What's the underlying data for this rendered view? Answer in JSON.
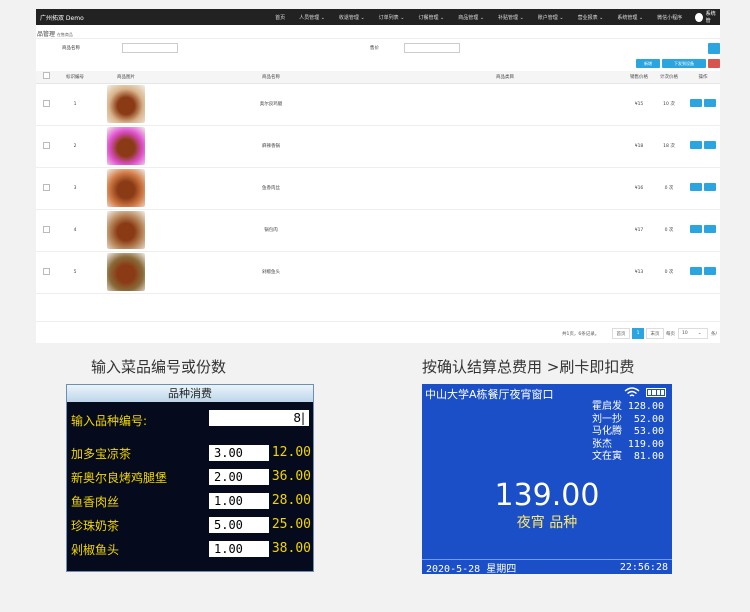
{
  "admin": {
    "brand": "广州拓双 Demo",
    "nav": [
      "首页",
      "人员管理 ⌄",
      "收退管理 ⌄",
      "订单列表 ⌄",
      "订餐管理 ⌄",
      "商品管理 ⌄",
      "补贴管理 ⌄",
      "账户管理 ⌄",
      "营业报表 ⌄",
      "系统管理 ⌄",
      "微信小程序"
    ],
    "user_label": "系统管",
    "breadcrumb": "品管理",
    "breadcrumb_sub": "在售商品",
    "filter_name_label": "商品名称",
    "filter_price_label": "售价",
    "add_label": "新增",
    "import_label": "下发到设备",
    "columns": [
      "标识编号",
      "商品图片",
      "商品名称",
      "商品类目",
      "销售价格",
      "计次价格",
      "操作"
    ],
    "rows": [
      {
        "id": "1",
        "name": "奥尔良鸡腿",
        "price": "¥15",
        "times": "10 次"
      },
      {
        "id": "2",
        "name": "麻辣香锅",
        "price": "¥18",
        "times": "18 次"
      },
      {
        "id": "3",
        "name": "鱼香肉丝",
        "price": "¥16",
        "times": "0 次"
      },
      {
        "id": "4",
        "name": "锅包肉",
        "price": "¥17",
        "times": "0 次"
      },
      {
        "id": "5",
        "name": "剁椒鱼头",
        "price": "¥13",
        "times": "0 次"
      }
    ],
    "pager": {
      "summary": "共1页，6条记录。",
      "first": "首页",
      "current": "1",
      "last": "末页",
      "per_page_label": "每页",
      "per_page_value": "10",
      "tail": "条/"
    }
  },
  "captions": {
    "left": "输入菜品编号或份数",
    "right": "按确认结算总费用 >刷卡即扣费"
  },
  "terminal1": {
    "header": "品种消费",
    "input_label": "输入品种编号:",
    "input_value": "8|",
    "items": [
      {
        "name": "加多宝凉茶",
        "qty": "3.00",
        "price": "12.00"
      },
      {
        "name": "新奥尔良烤鸡腿堡",
        "qty": "2.00",
        "price": "36.00"
      },
      {
        "name": "鱼香肉丝",
        "qty": "1.00",
        "price": "28.00"
      },
      {
        "name": "珍珠奶茶",
        "qty": "5.00",
        "price": "25.00"
      },
      {
        "name": "剁椒鱼头",
        "qty": "1.00",
        "price": "38.00"
      }
    ]
  },
  "terminal2": {
    "title": "中山大学A栋餐厅夜宵窗口",
    "records": [
      {
        "name": "霍启发",
        "amount": "128.00"
      },
      {
        "name": "刘一抄",
        "amount": "52.00"
      },
      {
        "name": "马化腾",
        "amount": "53.00"
      },
      {
        "name": "张杰",
        "amount": "119.00"
      },
      {
        "name": "文在寅",
        "amount": "81.00"
      }
    ],
    "total": "139.00",
    "mode": "夜宵 品种",
    "date": "2020-5-28 星期四",
    "time": "22:56:28"
  }
}
